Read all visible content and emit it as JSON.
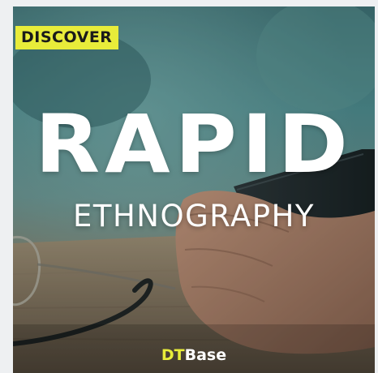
{
  "card": {
    "badge": "DISCOVER",
    "title_main": "RAPID",
    "title_sub": "ETHNOGRAPHY",
    "brand_prefix": "DT",
    "brand_suffix": "Base"
  },
  "colors": {
    "badge_bg": "#e8ec3a",
    "brand_accent": "#e8ec3a",
    "title_text": "#ffffff"
  }
}
